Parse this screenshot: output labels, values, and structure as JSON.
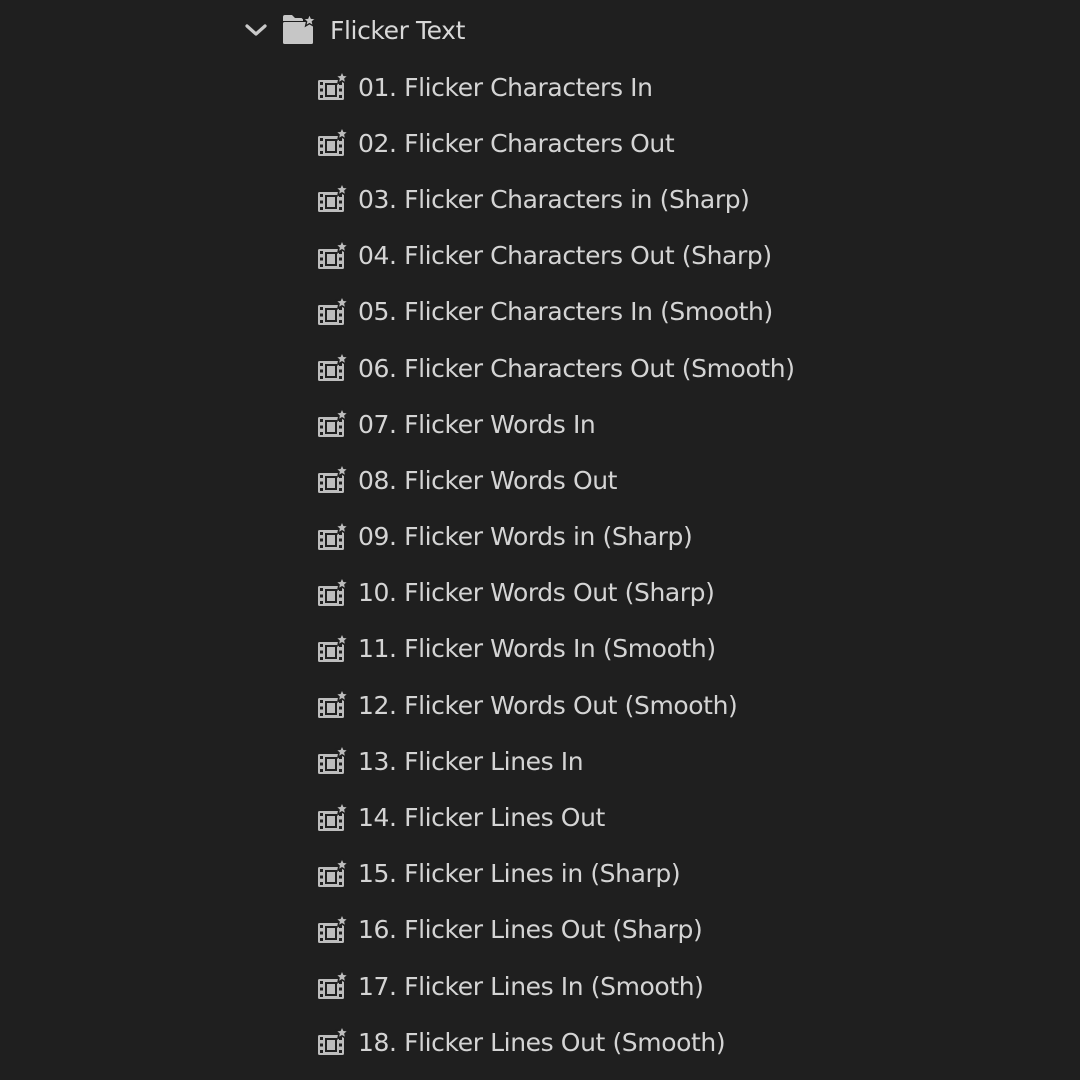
{
  "folder": {
    "label": "Flicker Text",
    "expanded": true,
    "icon": "preset-bin-icon",
    "toggle_icon": "chevron-down-icon"
  },
  "items": [
    {
      "label": "01. Flicker Characters In",
      "icon": "effect-preset-icon"
    },
    {
      "label": "02. Flicker Characters Out",
      "icon": "effect-preset-icon"
    },
    {
      "label": "03. Flicker Characters in (Sharp)",
      "icon": "effect-preset-icon"
    },
    {
      "label": "04. Flicker Characters Out (Sharp)",
      "icon": "effect-preset-icon"
    },
    {
      "label": "05. Flicker Characters In (Smooth)",
      "icon": "effect-preset-icon"
    },
    {
      "label": "06. Flicker Characters Out (Smooth)",
      "icon": "effect-preset-icon"
    },
    {
      "label": "07. Flicker Words In",
      "icon": "effect-preset-icon"
    },
    {
      "label": "08. Flicker Words Out",
      "icon": "effect-preset-icon"
    },
    {
      "label": "09. Flicker Words in (Sharp)",
      "icon": "effect-preset-icon"
    },
    {
      "label": "10. Flicker Words Out (Sharp)",
      "icon": "effect-preset-icon"
    },
    {
      "label": "11. Flicker Words In (Smooth)",
      "icon": "effect-preset-icon"
    },
    {
      "label": "12. Flicker Words Out (Smooth)",
      "icon": "effect-preset-icon"
    },
    {
      "label": "13. Flicker Lines In",
      "icon": "effect-preset-icon"
    },
    {
      "label": "14. Flicker Lines Out",
      "icon": "effect-preset-icon"
    },
    {
      "label": "15. Flicker Lines in (Sharp)",
      "icon": "effect-preset-icon"
    },
    {
      "label": "16. Flicker Lines Out (Sharp)",
      "icon": "effect-preset-icon"
    },
    {
      "label": "17. Flicker Lines In (Smooth)",
      "icon": "effect-preset-icon"
    },
    {
      "label": "18. Flicker Lines Out (Smooth)",
      "icon": "effect-preset-icon"
    }
  ],
  "colors": {
    "background": "#1f1f1f",
    "text": "#d4d4d4",
    "icon": "#bdbdbd"
  }
}
